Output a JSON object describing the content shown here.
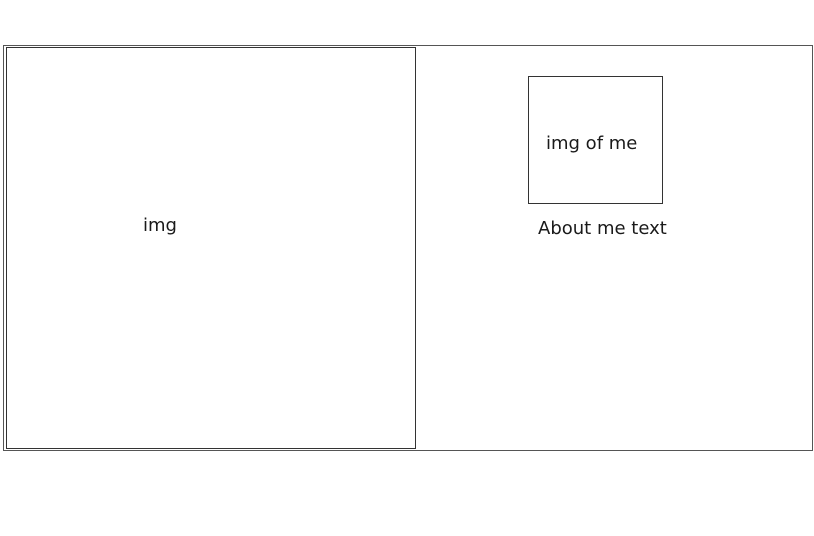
{
  "left_panel": {
    "label": "img"
  },
  "right_panel": {
    "profile_image_label": "img of me",
    "about_text": "About me text"
  }
}
